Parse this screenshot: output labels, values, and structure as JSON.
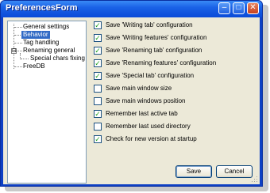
{
  "window": {
    "title": "PreferencesForm",
    "controls": {
      "minimize": "–",
      "maximize": "□",
      "close": "✕"
    }
  },
  "tree": {
    "items": [
      {
        "label": "General settings",
        "selected": false
      },
      {
        "label": "Behavior",
        "selected": true
      },
      {
        "label": "Tag handling",
        "selected": false
      },
      {
        "label": "Renaming general",
        "selected": false,
        "expander": "⊟"
      },
      {
        "label": "Special chars fixing",
        "selected": false
      },
      {
        "label": "FreeDB",
        "selected": false
      }
    ]
  },
  "options": [
    {
      "label": "Save 'Writing tab' configuration",
      "checked": true,
      "mark": "✓"
    },
    {
      "label": "Save 'Writing features' configuration",
      "checked": true,
      "mark": "✓"
    },
    {
      "label": "Save 'Renaming tab' configuration",
      "checked": true,
      "mark": "✓"
    },
    {
      "label": "Save 'Renaming features' configuration",
      "checked": true,
      "mark": "✓"
    },
    {
      "label": "Save 'Special tab' configuration",
      "checked": true,
      "mark": "✓"
    },
    {
      "label": "Save main window size",
      "checked": false,
      "mark": ""
    },
    {
      "label": "Save main windows position",
      "checked": false,
      "mark": ""
    },
    {
      "label": "Remember last active tab",
      "checked": true,
      "mark": "✓"
    },
    {
      "label": "Remember last used directory",
      "checked": false,
      "mark": ""
    },
    {
      "label": "Check for new version at startup",
      "checked": true,
      "mark": "✓"
    }
  ],
  "buttons": {
    "save": "Save",
    "cancel": "Cancel"
  },
  "colors": {
    "titlebar": "#0a4ad8",
    "selection": "#316ac5",
    "checkmark": "#21a121",
    "dialog_bg": "#ece9d8"
  }
}
